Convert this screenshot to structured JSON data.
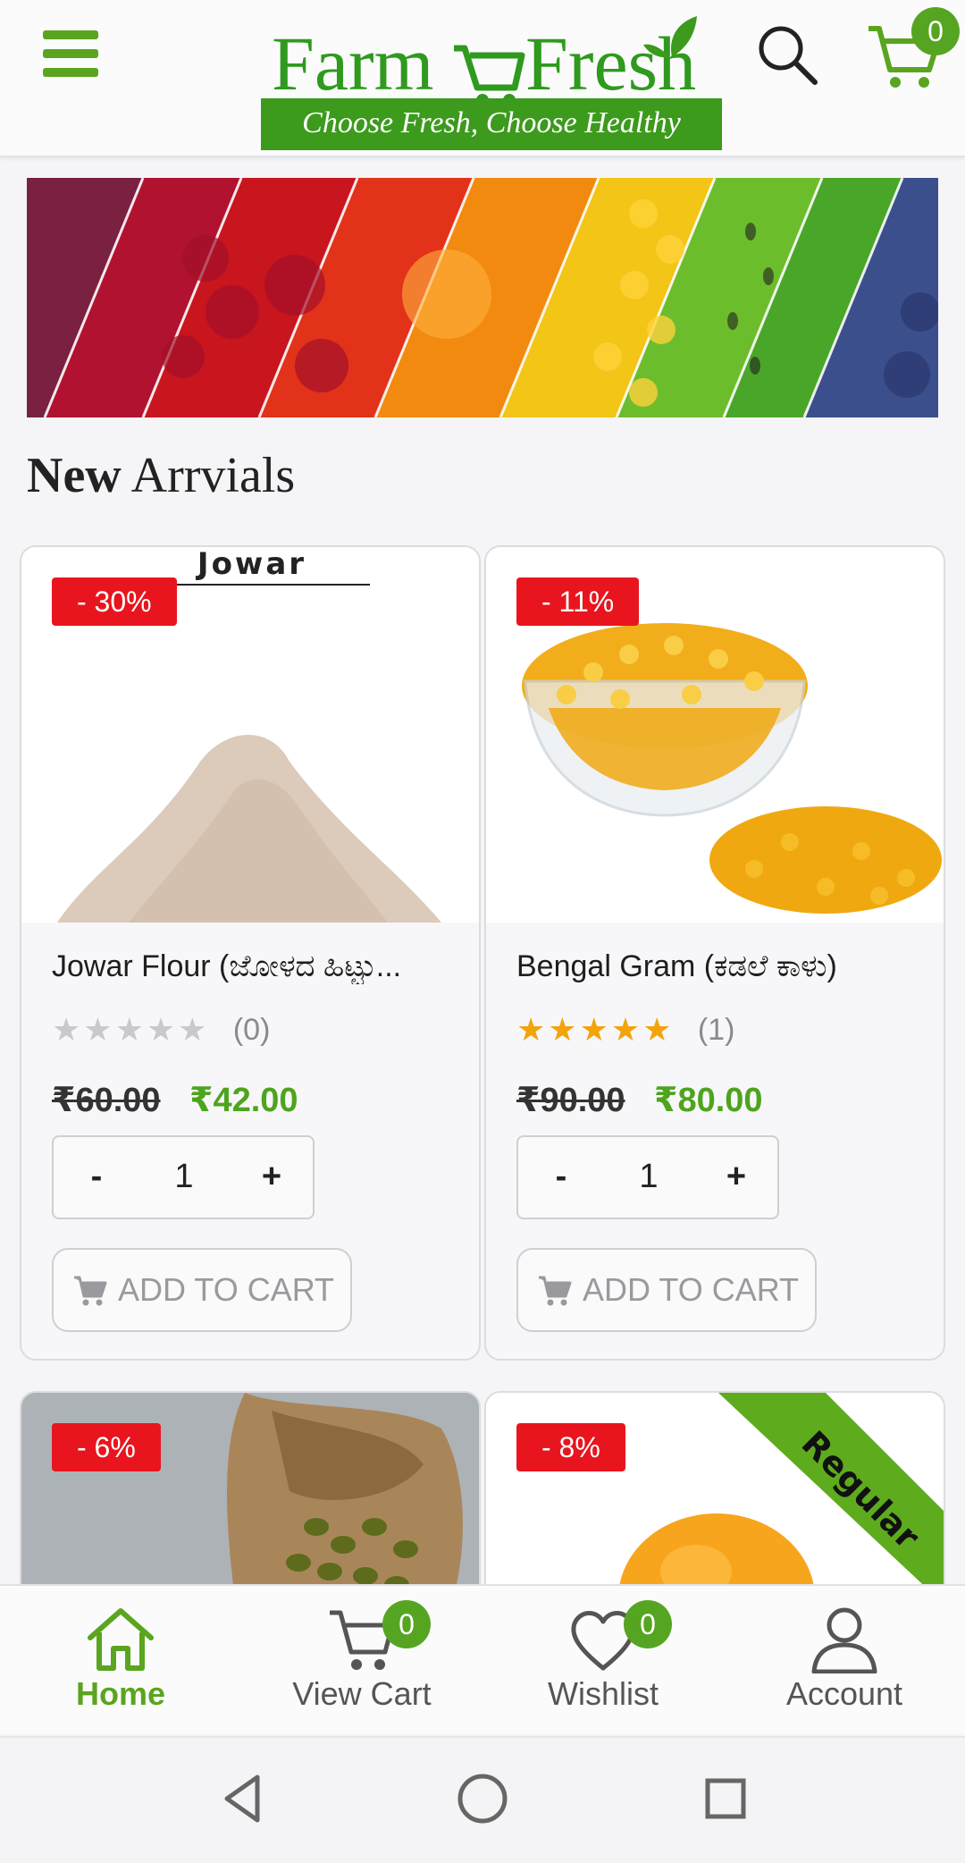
{
  "header": {
    "menu_icon": "hamburger-menu-icon",
    "logo": {
      "word1": "Farm",
      "word2": "Fresh",
      "tagline": "Choose Fresh, Choose Healthy"
    },
    "search_icon": "search-icon",
    "cart_icon": "cart-icon",
    "cart_count": "0",
    "brand_color": "#5aa51f"
  },
  "banner": {
    "description_colors": [
      "#8a1f3a",
      "#b9112a",
      "#d8241a",
      "#f28a10",
      "#f2c516",
      "#6cbd2c",
      "#4aa629",
      "#3b4f8c"
    ]
  },
  "section": {
    "title_bold": "New",
    "title_rest": "Arrvials"
  },
  "products": [
    {
      "discount": "- 30%",
      "image_text": "Jowar",
      "name": "Jowar Flour (ಜೋಳದ ಹಿಟ್ಟು...",
      "rating_stars": 0,
      "rating_count": "(0)",
      "old_price": "₹60.00",
      "new_price": "₹42.00",
      "qty_minus": "-",
      "qty": "1",
      "qty_plus": "+",
      "add_to_cart": "ADD TO CART"
    },
    {
      "discount": "- 11%",
      "name": "Bengal Gram (ಕಡಲೆ ಕಾಳು)",
      "rating_stars": 5,
      "rating_count": "(1)",
      "old_price": "₹90.00",
      "new_price": "₹80.00",
      "qty_minus": "-",
      "qty": "1",
      "qty_plus": "+",
      "add_to_cart": "ADD TO CART"
    },
    {
      "discount": "- 6%"
    },
    {
      "discount": "- 8%",
      "ribbon": "Regular"
    }
  ],
  "bottom_nav": {
    "items": [
      {
        "label": "Home",
        "icon": "home-icon",
        "active": true
      },
      {
        "label": "View Cart",
        "icon": "cart-icon",
        "badge": "0"
      },
      {
        "label": "Wishlist",
        "icon": "heart-icon",
        "badge": "0"
      },
      {
        "label": "Account",
        "icon": "person-icon"
      }
    ]
  },
  "system_nav": {
    "back": "back-triangle-icon",
    "home": "home-circle-icon",
    "recents": "recents-square-icon"
  }
}
